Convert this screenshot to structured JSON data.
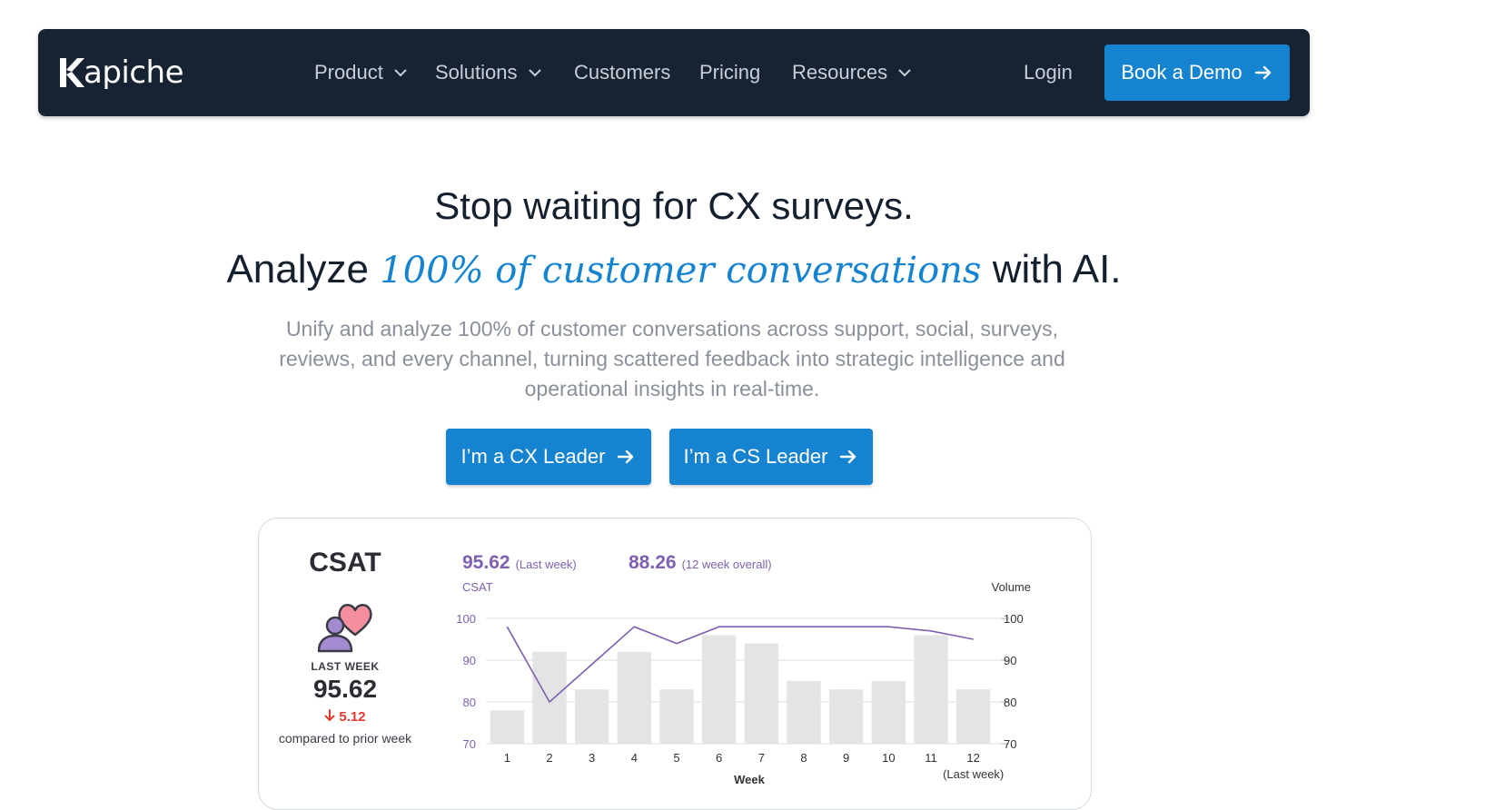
{
  "nav": {
    "logo": "kapiche",
    "items": [
      {
        "label": "Product",
        "dropdown": true
      },
      {
        "label": "Solutions",
        "dropdown": true
      },
      {
        "label": "Customers",
        "dropdown": false
      },
      {
        "label": "Pricing",
        "dropdown": false
      },
      {
        "label": "Resources",
        "dropdown": true
      }
    ],
    "login": "Login",
    "cta": "Book a Demo",
    "background": "#172333",
    "accent": "#1583cf"
  },
  "hero": {
    "title_line1": "Stop waiting for CX surveys.",
    "title_line2_before": "Analyze",
    "title_line2_highlight": "100% of customer conversations",
    "title_line2_after": "with AI.",
    "subtitle": "Unify and analyze 100% of customer conversations across support, social, surveys, reviews, and every channel, turning scattered feedback into strategic intelligence and operational insights in real-time.",
    "buttons": [
      "I’m a CX Leader",
      "I’m a CS Leader"
    ]
  },
  "csat_card": {
    "title": "CSAT",
    "icon": "heart-person-icon",
    "last_week_label": "LAST WEEK",
    "last_week_value": "95.62",
    "delta": "5.12",
    "delta_direction": "down",
    "compared_label": "compared to prior week",
    "stat_last_week_value": "95.62",
    "stat_last_week_label": "(Last week)",
    "stat_overall_value": "88.26",
    "stat_overall_label": "(12 week overall)"
  },
  "chart_data": {
    "type": "bar",
    "categories": [
      "1",
      "2",
      "3",
      "4",
      "5",
      "6",
      "7",
      "8",
      "9",
      "10",
      "11",
      "12"
    ],
    "xlabel": "Week",
    "last_week_note": "(Last week)",
    "left_axis": {
      "label": "CSAT",
      "ticks": [
        "100",
        "90",
        "80",
        "70"
      ],
      "ylim": [
        70,
        100
      ]
    },
    "right_axis": {
      "label": "Volume",
      "ticks": [
        "100",
        "90",
        "80",
        "70"
      ],
      "ylim": [
        70,
        100
      ]
    },
    "series": [
      {
        "type": "bar",
        "axis": "right",
        "color": "#e4e4e4",
        "values": [
          78,
          92,
          83,
          92,
          83,
          96,
          94,
          85,
          83,
          85,
          96,
          83
        ]
      },
      {
        "type": "line",
        "axis": "left",
        "color": "#7e5fb0",
        "values": [
          98,
          80,
          89,
          98,
          94,
          98,
          98,
          98,
          98,
          98,
          97,
          95
        ]
      }
    ],
    "grid": true
  }
}
